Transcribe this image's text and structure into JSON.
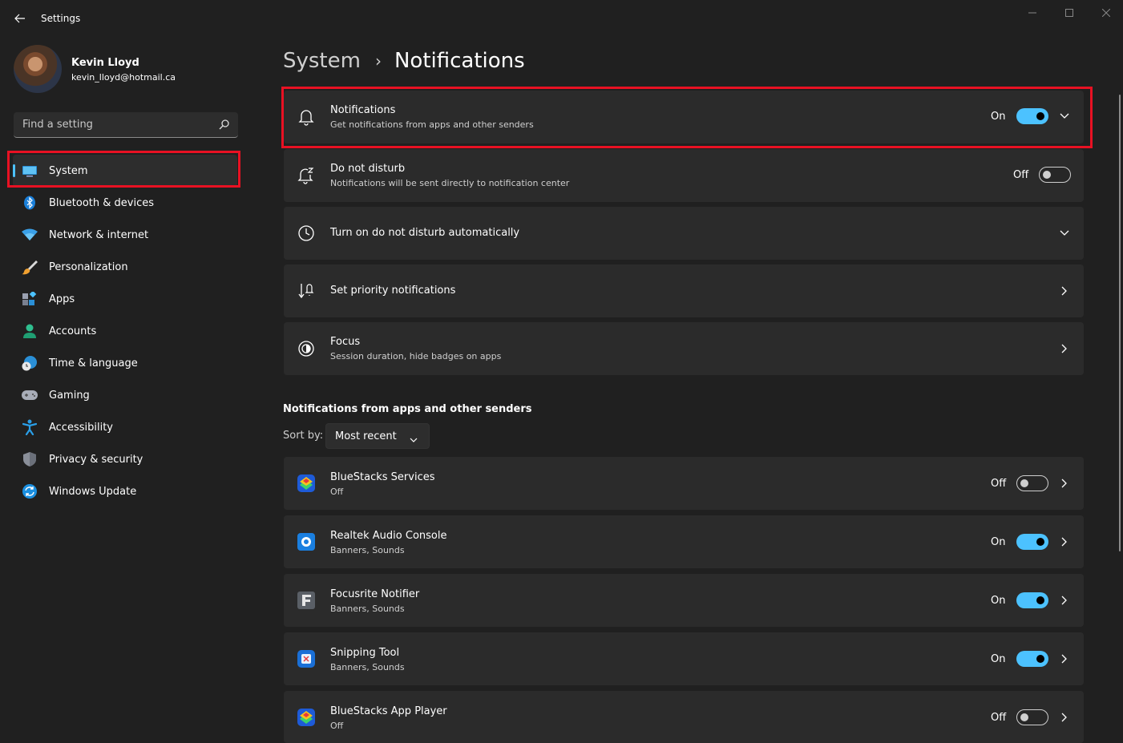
{
  "window": {
    "title": "Settings"
  },
  "profile": {
    "name": "Kevin Lloyd",
    "email": "kevin_lloyd@hotmail.ca"
  },
  "search": {
    "placeholder": "Find a setting"
  },
  "sidebar": {
    "items": [
      {
        "label": "System",
        "icon": "system-icon",
        "selected": true
      },
      {
        "label": "Bluetooth & devices",
        "icon": "bluetooth-icon"
      },
      {
        "label": "Network & internet",
        "icon": "wifi-icon"
      },
      {
        "label": "Personalization",
        "icon": "brush-icon"
      },
      {
        "label": "Apps",
        "icon": "apps-icon"
      },
      {
        "label": "Accounts",
        "icon": "person-icon"
      },
      {
        "label": "Time & language",
        "icon": "globe-clock-icon"
      },
      {
        "label": "Gaming",
        "icon": "gamepad-icon"
      },
      {
        "label": "Accessibility",
        "icon": "accessibility-icon"
      },
      {
        "label": "Privacy & security",
        "icon": "shield-icon"
      },
      {
        "label": "Windows Update",
        "icon": "update-icon"
      }
    ]
  },
  "breadcrumb": {
    "parent": "System",
    "separator": "›",
    "current": "Notifications"
  },
  "settings": {
    "notifications": {
      "title": "Notifications",
      "subtitle": "Get notifications from apps and other senders",
      "state": "On"
    },
    "dnd": {
      "title": "Do not disturb",
      "subtitle": "Notifications will be sent directly to notification center",
      "state": "Off"
    },
    "dnd_auto": {
      "title": "Turn on do not disturb automatically"
    },
    "priority": {
      "title": "Set priority notifications"
    },
    "focus": {
      "title": "Focus",
      "subtitle": "Session duration, hide badges on apps"
    }
  },
  "apps_section": {
    "title": "Notifications from apps and other senders",
    "sort_label": "Sort by:",
    "sort_value": "Most recent",
    "apps": [
      {
        "name": "BlueStacks Services",
        "detail": "Off",
        "state": "Off"
      },
      {
        "name": "Realtek Audio Console",
        "detail": "Banners, Sounds",
        "state": "On"
      },
      {
        "name": "Focusrite Notifier",
        "detail": "Banners, Sounds",
        "state": "On"
      },
      {
        "name": "Snipping Tool",
        "detail": "Banners, Sounds",
        "state": "On"
      },
      {
        "name": "BlueStacks App Player",
        "detail": "Off",
        "state": "Off"
      }
    ]
  },
  "colors": {
    "accent": "#4cc2ff",
    "highlight": "#e81123",
    "background": "#202020",
    "card": "#2b2b2b"
  }
}
